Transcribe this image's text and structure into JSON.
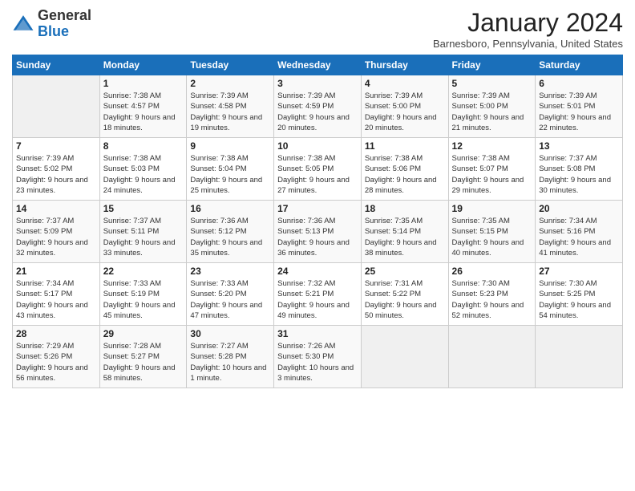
{
  "logo": {
    "text_general": "General",
    "text_blue": "Blue"
  },
  "title": "January 2024",
  "location": "Barnesboro, Pennsylvania, United States",
  "days_of_week": [
    "Sunday",
    "Monday",
    "Tuesday",
    "Wednesday",
    "Thursday",
    "Friday",
    "Saturday"
  ],
  "weeks": [
    [
      {
        "num": "",
        "empty": true
      },
      {
        "num": "1",
        "sunrise": "Sunrise: 7:38 AM",
        "sunset": "Sunset: 4:57 PM",
        "daylight": "Daylight: 9 hours and 18 minutes."
      },
      {
        "num": "2",
        "sunrise": "Sunrise: 7:39 AM",
        "sunset": "Sunset: 4:58 PM",
        "daylight": "Daylight: 9 hours and 19 minutes."
      },
      {
        "num": "3",
        "sunrise": "Sunrise: 7:39 AM",
        "sunset": "Sunset: 4:59 PM",
        "daylight": "Daylight: 9 hours and 20 minutes."
      },
      {
        "num": "4",
        "sunrise": "Sunrise: 7:39 AM",
        "sunset": "Sunset: 5:00 PM",
        "daylight": "Daylight: 9 hours and 20 minutes."
      },
      {
        "num": "5",
        "sunrise": "Sunrise: 7:39 AM",
        "sunset": "Sunset: 5:00 PM",
        "daylight": "Daylight: 9 hours and 21 minutes."
      },
      {
        "num": "6",
        "sunrise": "Sunrise: 7:39 AM",
        "sunset": "Sunset: 5:01 PM",
        "daylight": "Daylight: 9 hours and 22 minutes."
      }
    ],
    [
      {
        "num": "7",
        "sunrise": "Sunrise: 7:39 AM",
        "sunset": "Sunset: 5:02 PM",
        "daylight": "Daylight: 9 hours and 23 minutes."
      },
      {
        "num": "8",
        "sunrise": "Sunrise: 7:38 AM",
        "sunset": "Sunset: 5:03 PM",
        "daylight": "Daylight: 9 hours and 24 minutes."
      },
      {
        "num": "9",
        "sunrise": "Sunrise: 7:38 AM",
        "sunset": "Sunset: 5:04 PM",
        "daylight": "Daylight: 9 hours and 25 minutes."
      },
      {
        "num": "10",
        "sunrise": "Sunrise: 7:38 AM",
        "sunset": "Sunset: 5:05 PM",
        "daylight": "Daylight: 9 hours and 27 minutes."
      },
      {
        "num": "11",
        "sunrise": "Sunrise: 7:38 AM",
        "sunset": "Sunset: 5:06 PM",
        "daylight": "Daylight: 9 hours and 28 minutes."
      },
      {
        "num": "12",
        "sunrise": "Sunrise: 7:38 AM",
        "sunset": "Sunset: 5:07 PM",
        "daylight": "Daylight: 9 hours and 29 minutes."
      },
      {
        "num": "13",
        "sunrise": "Sunrise: 7:37 AM",
        "sunset": "Sunset: 5:08 PM",
        "daylight": "Daylight: 9 hours and 30 minutes."
      }
    ],
    [
      {
        "num": "14",
        "sunrise": "Sunrise: 7:37 AM",
        "sunset": "Sunset: 5:09 PM",
        "daylight": "Daylight: 9 hours and 32 minutes."
      },
      {
        "num": "15",
        "sunrise": "Sunrise: 7:37 AM",
        "sunset": "Sunset: 5:11 PM",
        "daylight": "Daylight: 9 hours and 33 minutes."
      },
      {
        "num": "16",
        "sunrise": "Sunrise: 7:36 AM",
        "sunset": "Sunset: 5:12 PM",
        "daylight": "Daylight: 9 hours and 35 minutes."
      },
      {
        "num": "17",
        "sunrise": "Sunrise: 7:36 AM",
        "sunset": "Sunset: 5:13 PM",
        "daylight": "Daylight: 9 hours and 36 minutes."
      },
      {
        "num": "18",
        "sunrise": "Sunrise: 7:35 AM",
        "sunset": "Sunset: 5:14 PM",
        "daylight": "Daylight: 9 hours and 38 minutes."
      },
      {
        "num": "19",
        "sunrise": "Sunrise: 7:35 AM",
        "sunset": "Sunset: 5:15 PM",
        "daylight": "Daylight: 9 hours and 40 minutes."
      },
      {
        "num": "20",
        "sunrise": "Sunrise: 7:34 AM",
        "sunset": "Sunset: 5:16 PM",
        "daylight": "Daylight: 9 hours and 41 minutes."
      }
    ],
    [
      {
        "num": "21",
        "sunrise": "Sunrise: 7:34 AM",
        "sunset": "Sunset: 5:17 PM",
        "daylight": "Daylight: 9 hours and 43 minutes."
      },
      {
        "num": "22",
        "sunrise": "Sunrise: 7:33 AM",
        "sunset": "Sunset: 5:19 PM",
        "daylight": "Daylight: 9 hours and 45 minutes."
      },
      {
        "num": "23",
        "sunrise": "Sunrise: 7:33 AM",
        "sunset": "Sunset: 5:20 PM",
        "daylight": "Daylight: 9 hours and 47 minutes."
      },
      {
        "num": "24",
        "sunrise": "Sunrise: 7:32 AM",
        "sunset": "Sunset: 5:21 PM",
        "daylight": "Daylight: 9 hours and 49 minutes."
      },
      {
        "num": "25",
        "sunrise": "Sunrise: 7:31 AM",
        "sunset": "Sunset: 5:22 PM",
        "daylight": "Daylight: 9 hours and 50 minutes."
      },
      {
        "num": "26",
        "sunrise": "Sunrise: 7:30 AM",
        "sunset": "Sunset: 5:23 PM",
        "daylight": "Daylight: 9 hours and 52 minutes."
      },
      {
        "num": "27",
        "sunrise": "Sunrise: 7:30 AM",
        "sunset": "Sunset: 5:25 PM",
        "daylight": "Daylight: 9 hours and 54 minutes."
      }
    ],
    [
      {
        "num": "28",
        "sunrise": "Sunrise: 7:29 AM",
        "sunset": "Sunset: 5:26 PM",
        "daylight": "Daylight: 9 hours and 56 minutes."
      },
      {
        "num": "29",
        "sunrise": "Sunrise: 7:28 AM",
        "sunset": "Sunset: 5:27 PM",
        "daylight": "Daylight: 9 hours and 58 minutes."
      },
      {
        "num": "30",
        "sunrise": "Sunrise: 7:27 AM",
        "sunset": "Sunset: 5:28 PM",
        "daylight": "Daylight: 10 hours and 1 minute."
      },
      {
        "num": "31",
        "sunrise": "Sunrise: 7:26 AM",
        "sunset": "Sunset: 5:30 PM",
        "daylight": "Daylight: 10 hours and 3 minutes."
      },
      {
        "num": "",
        "empty": true
      },
      {
        "num": "",
        "empty": true
      },
      {
        "num": "",
        "empty": true
      }
    ]
  ]
}
